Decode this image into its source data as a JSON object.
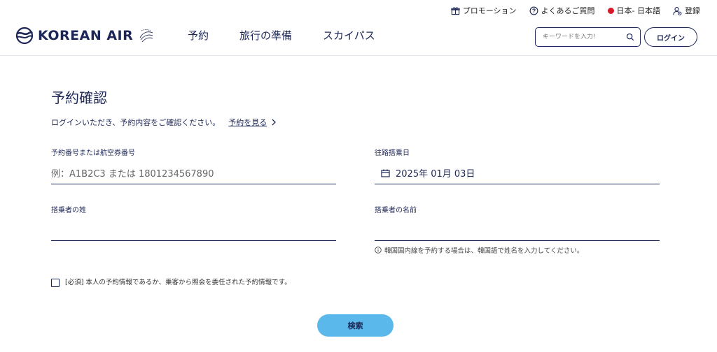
{
  "utility_bar": {
    "promotion": "プロモーション",
    "faq": "よくあるご質問",
    "language": "日本- 日本語",
    "register": "登録"
  },
  "header": {
    "logo_text": "KOREAN AIR",
    "nav": [
      "予約",
      "旅行の準備",
      "スカイパス"
    ],
    "search_placeholder": "キーワードを入力!",
    "login_label": "ログイン"
  },
  "main": {
    "title": "予約確認",
    "intro_text": "ログインいただき、予約内容をご確認ください。",
    "intro_link": "予約を見る",
    "fields": {
      "booking_number": {
        "label": "予約番号または航空券番号",
        "placeholder": "例：A1B2C3 または 1801234567890"
      },
      "departure_date": {
        "label": "往路搭乗日",
        "value": "2025年 01月 03日"
      },
      "last_name": {
        "label": "搭乗者の姓",
        "value": ""
      },
      "first_name": {
        "label": "搭乗者の名前",
        "value": ""
      }
    },
    "hint": "韓国国内線を予約する場合は、韓国語で姓名を入力してください。",
    "agreement": "[必須] 本人の予約情報であるか、乗客から照会を委任された予約情報です。",
    "search_button": "検索"
  },
  "colors": {
    "navy": "#1d2757",
    "accent_blue": "#5bb8ea",
    "flag_red": "#d7182a"
  }
}
